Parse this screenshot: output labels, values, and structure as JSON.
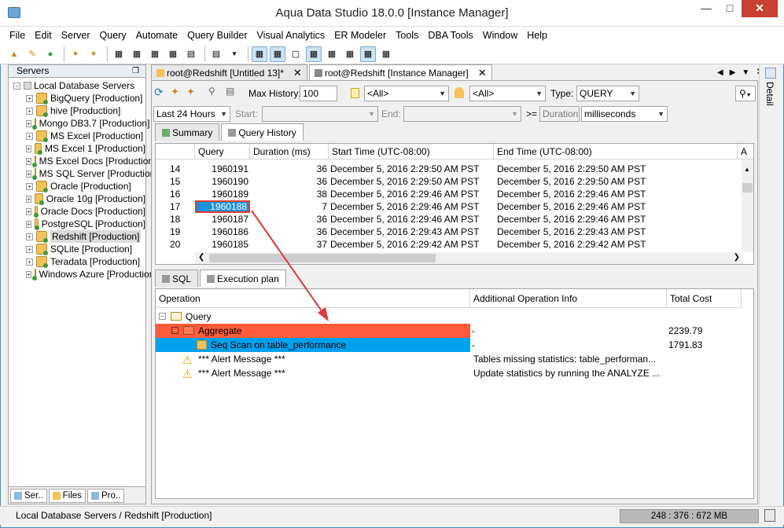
{
  "window": {
    "title": "Aqua Data Studio 18.0.0 [Instance Manager]"
  },
  "menu": [
    "File",
    "Edit",
    "Server",
    "Query",
    "Automate",
    "Query Builder",
    "Visual Analytics",
    "ER Modeler",
    "Tools",
    "DBA Tools",
    "Window",
    "Help"
  ],
  "servers_panel": {
    "header": "Servers",
    "root": "Local Database Servers",
    "items": [
      "BigQuery [Production]",
      "hive [Production]",
      "Mongo DB3.7 [Production]",
      "MS Excel [Production]",
      "MS Excel 1 [Production]",
      "MS Excel Docs [Production]",
      "MS SQL Server [Production]",
      "Oracle [Production]",
      "Oracle 10g [Production]",
      "Oracle Docs [Production]",
      "PostgreSQL [Production]",
      "Redshift [Production]",
      "SQLite [Production]",
      "Teradata [Production]",
      "Windows Azure [Production]"
    ],
    "selected_index": 11,
    "tabs": [
      "Ser..",
      "Files",
      "Pro.."
    ]
  },
  "doc_tabs": [
    {
      "label": "root@Redshift [Untitled 13]*",
      "active": false
    },
    {
      "label": "root@Redshift [Instance Manager]",
      "active": true
    }
  ],
  "right_strip": {
    "label": "Detail"
  },
  "filters": {
    "max_history_label": "Max History:",
    "max_history_value": "100",
    "all1": "<All>",
    "all2": "<All>",
    "type_label": "Type:",
    "type_value": "QUERY",
    "range_value": "Last 24 Hours",
    "start_label": "Start:",
    "end_label": "End:",
    "ge_label": ">=",
    "duration_placeholder": "Duration",
    "units_value": "milliseconds"
  },
  "subtabs": [
    "Summary",
    "Query History"
  ],
  "history_grid": {
    "columns": [
      "Query",
      "Duration (ms)",
      "Start Time (UTC-08:00)",
      "End Time (UTC-08:00)",
      "A"
    ],
    "rows": [
      {
        "n": "14",
        "query": "1960191",
        "duration": "36",
        "start": "December 5, 2016 2:29:50 AM PST",
        "end": "December 5, 2016 2:29:50 AM PST"
      },
      {
        "n": "15",
        "query": "1960190",
        "duration": "36",
        "start": "December 5, 2016 2:29:50 AM PST",
        "end": "December 5, 2016 2:29:50 AM PST"
      },
      {
        "n": "16",
        "query": "1960189",
        "duration": "38",
        "start": "December 5, 2016 2:29:46 AM PST",
        "end": "December 5, 2016 2:29:46 AM PST"
      },
      {
        "n": "17",
        "query": "1960188",
        "duration": "7",
        "start": "December 5, 2016 2:29:46 AM PST",
        "end": "December 5, 2016 2:29:46 AM PST"
      },
      {
        "n": "18",
        "query": "1960187",
        "duration": "36",
        "start": "December 5, 2016 2:29:46 AM PST",
        "end": "December 5, 2016 2:29:46 AM PST"
      },
      {
        "n": "19",
        "query": "1960186",
        "duration": "36",
        "start": "December 5, 2016 2:29:43 AM PST",
        "end": "December 5, 2016 2:29:43 AM PST"
      },
      {
        "n": "20",
        "query": "1960185",
        "duration": "37",
        "start": "December 5, 2016 2:29:42 AM PST",
        "end": "December 5, 2016 2:29:42 AM PST"
      }
    ],
    "selected_row": 3
  },
  "lower_tabs": [
    "SQL",
    "Execution plan"
  ],
  "plan": {
    "columns": [
      "Operation",
      "Additional Operation Info",
      "Total Cost"
    ],
    "rows": [
      {
        "op": "Query",
        "info": "",
        "cost": ""
      },
      {
        "op": "Aggregate",
        "info": "-",
        "cost": "2239.79"
      },
      {
        "op": "Seq Scan on table_performance",
        "info": "-",
        "cost": "1791.83"
      },
      {
        "op": "*** Alert Message ***",
        "info": "Tables missing statistics: table_performan...",
        "cost": ""
      },
      {
        "op": "*** Alert Message ***",
        "info": "Update statistics by running the ANALYZE ...",
        "cost": ""
      }
    ]
  },
  "status": {
    "path": "Local Database Servers / Redshift [Production]",
    "memory": "248 : 376 : 672 MB"
  },
  "colors": {
    "aggregate_row": "#ff5b3a",
    "seqscan_row": "#00a2ee",
    "selection_blue": "#1f8fde",
    "annotation_arrow": "#e0393c",
    "close_button": "#c84031"
  }
}
